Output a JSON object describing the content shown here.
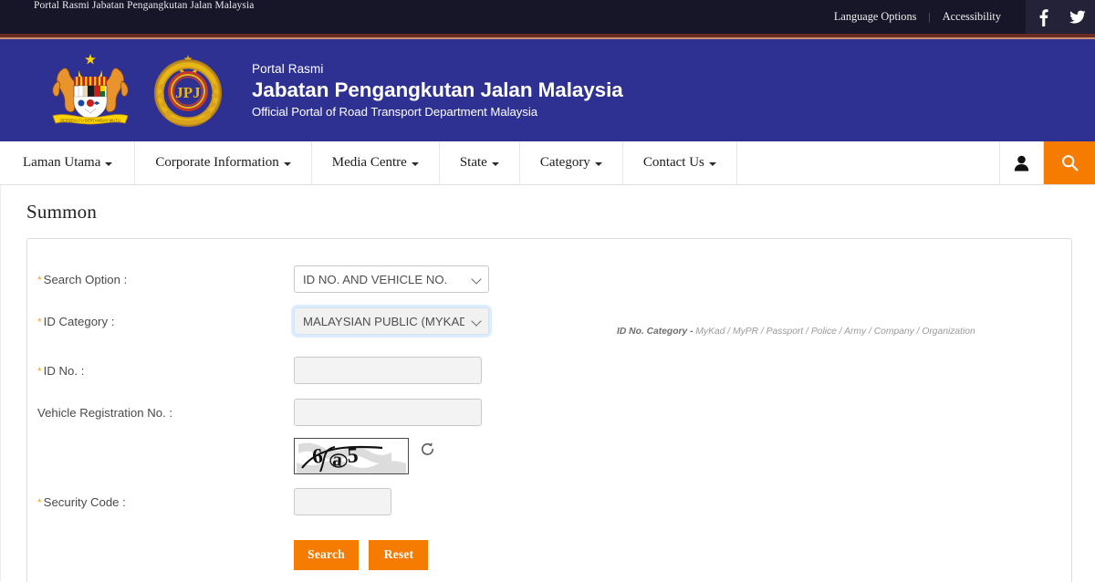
{
  "topbar": {
    "site_title": "Portal Rasmi Jabatan Pengangkutan Jalan Malaysia",
    "language_options": "Language Options",
    "separator": "|",
    "accessibility": "Accessibility",
    "facebook_icon": "facebook-icon",
    "twitter_icon": "twitter-icon",
    "bg_color": "#171628"
  },
  "banner": {
    "pre_title": "Portal Rasmi",
    "title": "Jabatan Pengangkutan Jalan Malaysia",
    "subtitle": "Official Portal of Road Transport Department Malaysia",
    "crest_icon": "malaysia-coat-of-arms",
    "jpj_icon": "jpj-emblem",
    "bg_color": "#2E3192"
  },
  "nav": {
    "items": [
      {
        "label": "Laman Utama",
        "has_caret": true
      },
      {
        "label": "Corporate Information",
        "has_caret": true
      },
      {
        "label": "Media Centre",
        "has_caret": true
      },
      {
        "label": "State",
        "has_caret": true
      },
      {
        "label": "Category",
        "has_caret": true
      },
      {
        "label": "Contact Us",
        "has_caret": true
      }
    ],
    "user_icon": "user-icon",
    "search_icon": "search-icon",
    "search_bg": "#F57C00"
  },
  "main": {
    "page_title": "Summon",
    "required_mark": "*",
    "fields": {
      "search_option": {
        "label": "Search Option :",
        "required": true,
        "value": "ID NO. AND VEHICLE NO.",
        "focused": false
      },
      "id_category": {
        "label": "ID Category :",
        "required": true,
        "value": "MALAYSIAN PUBLIC (MYKAD)",
        "focused": true
      },
      "id_no": {
        "label": "ID No. :",
        "required": true,
        "value": "",
        "placeholder": ""
      },
      "vehicle_reg_no": {
        "label": "Vehicle Registration No. :",
        "required": false,
        "value": "",
        "placeholder": ""
      },
      "security_code": {
        "label": "Security Code :",
        "required": true,
        "value": "",
        "placeholder": ""
      }
    },
    "hint": {
      "label": "ID No. Category -",
      "text": " MyKad / MyPR / Passport / Police / Army / Company / Organization"
    },
    "captcha": {
      "text": "6a5",
      "refresh_icon": "refresh-icon",
      "alt": "captcha-image"
    },
    "buttons": {
      "search": "Search",
      "reset": "Reset",
      "color": "#F57C00"
    }
  }
}
